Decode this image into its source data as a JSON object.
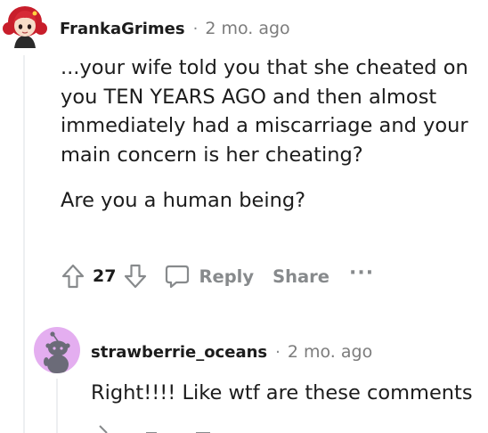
{
  "comments": [
    {
      "author": "FrankaGrimes",
      "separator": "·",
      "time": "2 mo. ago",
      "paragraphs": [
        "...your wife told you that she cheated on you TEN YEARS AGO and then almost immediately had a miscarriage and your main concern is her cheating?",
        "Are you a human being?"
      ],
      "score": "27",
      "reply_label": "Reply",
      "share_label": "Share",
      "more_label": "···",
      "avatar": "red-haired-girl-avatar"
    },
    {
      "author": "strawberrie_oceans",
      "separator": "·",
      "time": "2 mo. ago",
      "text": "Right!!!! Like wtf are these comments",
      "avatar": "snoo-avatar"
    }
  ],
  "colors": {
    "text": "#1c1c1c",
    "muted": "#878a8c",
    "thread_line": "#edeff1",
    "avatar2_bg": "#e4aef0"
  }
}
